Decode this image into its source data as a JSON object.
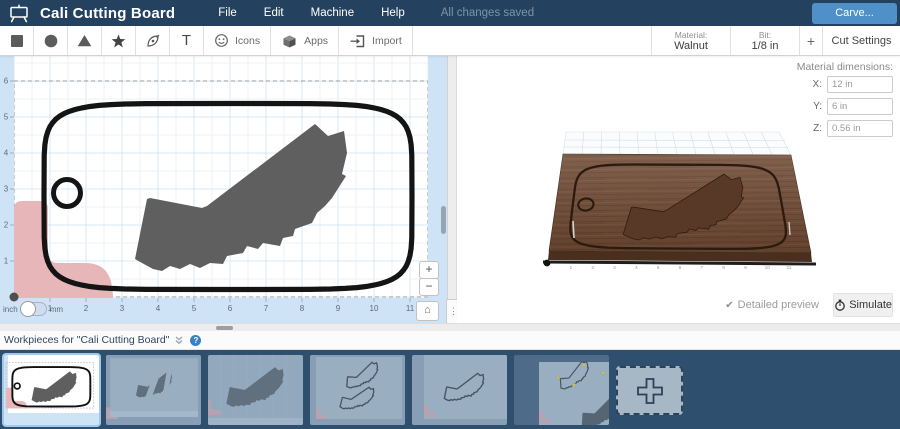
{
  "navbar": {
    "title": "Cali Cutting Board",
    "menus": [
      "File",
      "Edit",
      "Machine",
      "Help"
    ],
    "saved_status": "All changes saved",
    "carve_label": "Carve..."
  },
  "toolbar": {
    "icons_label": "Icons",
    "apps_label": "Apps",
    "import_label": "Import",
    "text_tool_label": "T",
    "material_label": "Material:",
    "material_value": "Walnut",
    "bit_label": "Bit:",
    "bit_value": "1/8 in",
    "add_bit_label": "+",
    "cut_settings_label": "Cut Settings"
  },
  "canvas": {
    "unit_inch": "inch",
    "unit_mm": "mm",
    "x_ticks": [
      1,
      2,
      3,
      4,
      5,
      6,
      7,
      8,
      9,
      10,
      11
    ],
    "y_ticks": [
      1,
      2,
      3,
      4,
      5,
      6
    ],
    "zoom_in_label": "+",
    "zoom_out_label": "−",
    "home_icon": "⌂",
    "splitter_icon": "⋮"
  },
  "preview": {
    "dims_label": "Material dimensions:",
    "rows": [
      {
        "label": "X:",
        "value": "12 in"
      },
      {
        "label": "Y:",
        "value": "6 in"
      },
      {
        "label": "Z:",
        "value": "0.56 in"
      }
    ],
    "ruler_ticks": [
      1,
      2,
      3,
      4,
      5,
      6,
      7,
      8,
      9,
      10,
      11
    ],
    "detailed_check": "✔",
    "detailed_label": "Detailed preview",
    "simulate_label": "Simulate"
  },
  "workpieces": {
    "header": "Workpieces for \"Cali Cutting Board\"",
    "collapse_icon": "⌄",
    "help_icon": "?"
  },
  "colors": {
    "navy": "#24425f",
    "panel_navy": "#2f4f6e",
    "accent_blue": "#4f90c9",
    "ruler_blue": "#cfe3f6",
    "pink": "#e7b6b8",
    "shape_gray": "#5f5f5f",
    "walnut": "#6f4a33"
  }
}
